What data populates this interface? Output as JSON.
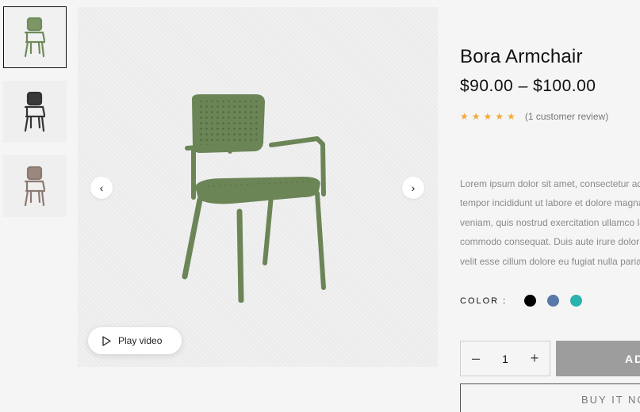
{
  "gallery": {
    "thumbnails": [
      {
        "name": "green-chair",
        "color": "#6f8a5b"
      },
      {
        "name": "black-chair",
        "color": "#333333"
      },
      {
        "name": "taupe-chair",
        "color": "#8b7a72"
      }
    ],
    "main_chair_color": "#6b8557",
    "prev_icon": "chevron-left-icon",
    "next_icon": "chevron-right-icon",
    "prev_glyph": "‹",
    "next_glyph": "›",
    "play_label": "Play video"
  },
  "product": {
    "title": "Bora Armchair",
    "price": "$90.00 – $100.00",
    "stars": [
      "★",
      "★",
      "★",
      "★",
      "★"
    ],
    "star_color": "#f2a93b",
    "review_text": "(1 customer review)",
    "description_lines": [
      "Lorem ipsum dolor sit amet, consectetur ad",
      "tempor incididunt ut labore et dolore magna",
      "veniam, quis nostrud exercitation ullamco la",
      "commodo consequat. Duis aute irure dolor i",
      "velit esse cillum dolore eu fugiat nulla pariat"
    ],
    "color_label": "COLOR :",
    "colors": [
      "#000000",
      "#5878a8",
      "#2bb3ad"
    ],
    "quantity": "1",
    "minus": "–",
    "plus": "+",
    "add_label": "AD",
    "buy_label": "BUY IT NOW"
  }
}
